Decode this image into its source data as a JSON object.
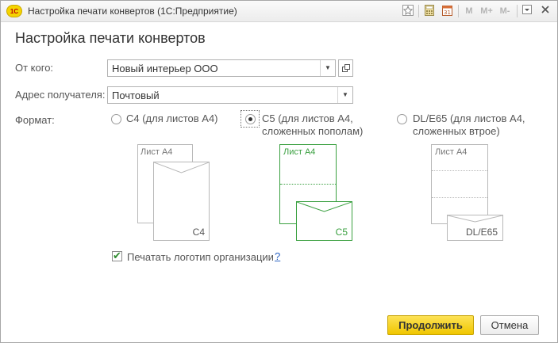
{
  "window": {
    "title": "Настройка печати конвертов (1С:Предприятие)",
    "logo": "1С",
    "toolbar": {
      "m": "M",
      "mplus": "M+",
      "mminus": "M-"
    }
  },
  "form": {
    "heading": "Настройка печати конвертов",
    "from_label": "От кого:",
    "from_value": "Новый интерьер ООО",
    "address_label": "Адрес получателя:",
    "address_value": "Почтовый",
    "format_label": "Формат:",
    "formats": [
      {
        "line1": "С4 (для листов А4)",
        "line2": "",
        "selected": false
      },
      {
        "line1": "С5 (для листов А4,",
        "line2": "сложенных пополам)",
        "selected": true
      },
      {
        "line1": "DL/E65 (для листов А4,",
        "line2": "сложенных втрое)",
        "selected": false
      }
    ],
    "previews": {
      "sheet_label": "Лист А4",
      "c4": "С4",
      "c5": "С5",
      "dl": "DL/E65"
    },
    "print_logo_label": "Печатать логотип организации",
    "print_logo_checked": true,
    "help": "?"
  },
  "buttons": {
    "continue": "Продолжить",
    "cancel": "Отмена"
  },
  "colors": {
    "accent": "#f0c600",
    "green": "#3aa040",
    "gray": "#b8b8b8"
  }
}
